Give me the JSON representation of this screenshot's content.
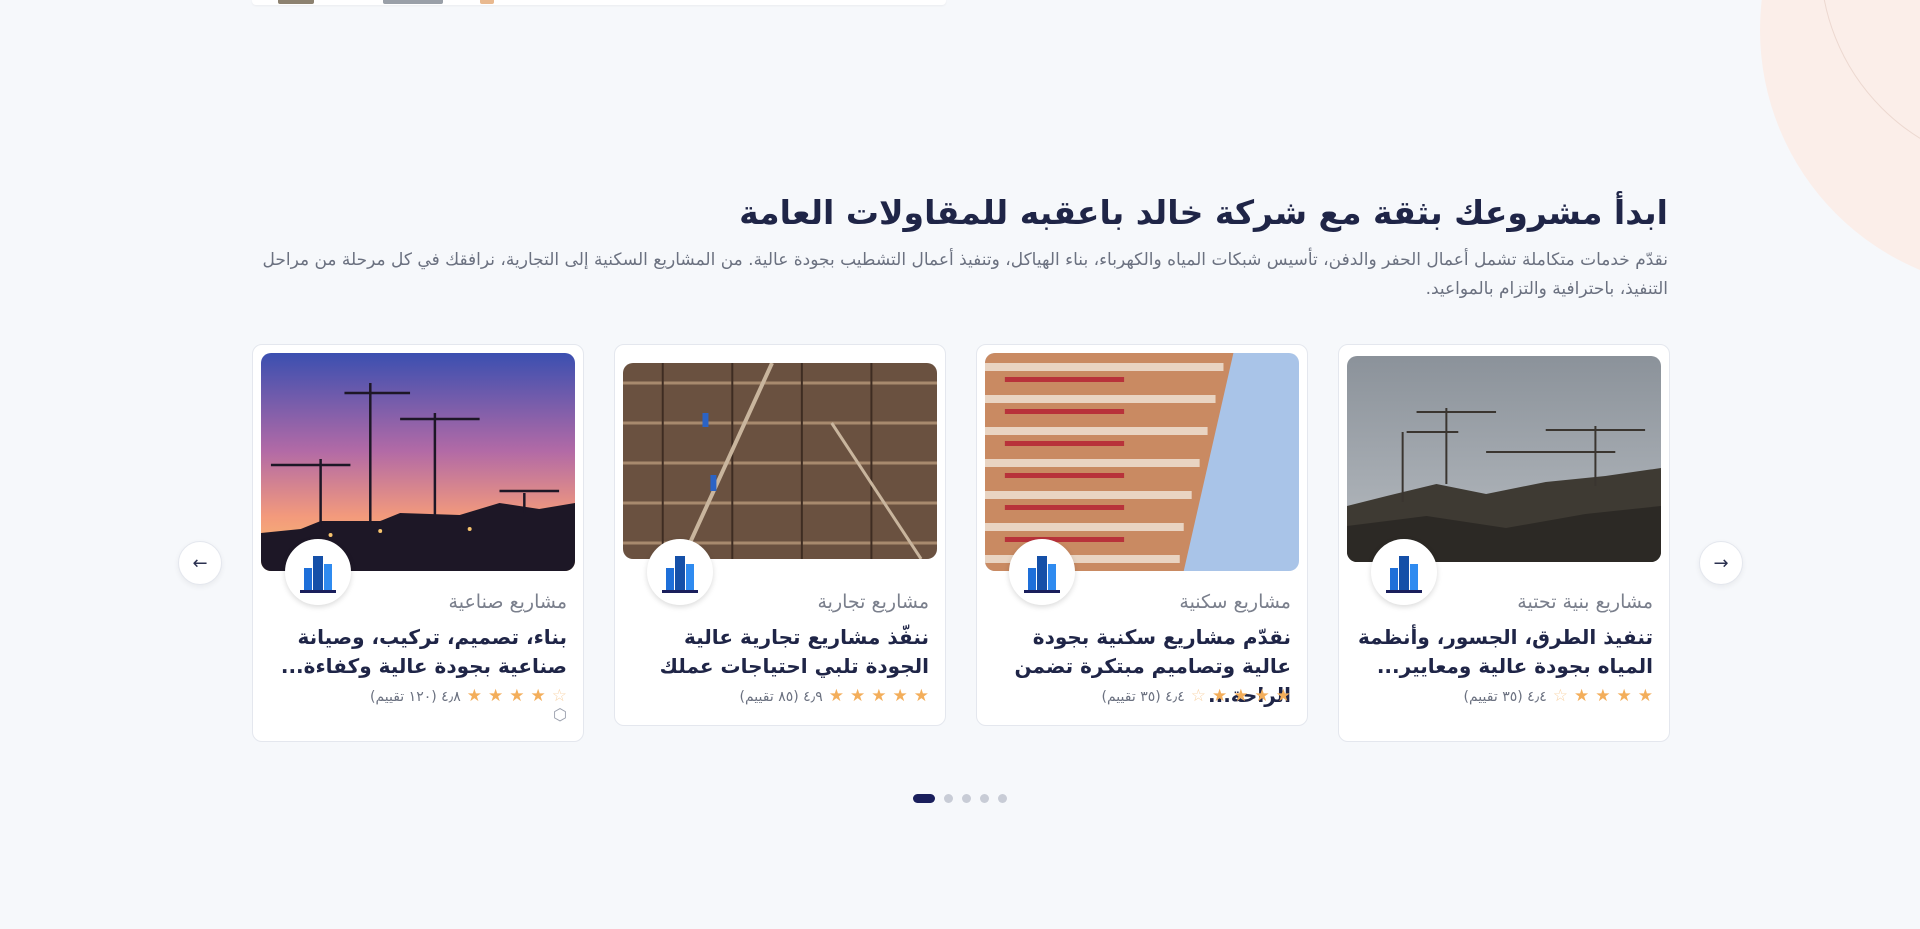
{
  "section": {
    "title": "ابدأ مشروعك بثقة مع شركة خالد باعقبه للمقاولات العامة",
    "description": "نقدّم خدمات متكاملة تشمل أعمال الحفر والدفن، تأسيس شبكات المياه والكهرباء، بناء الهياكل، وتنفيذ أعمال التشطيب بجودة عالية. من المشاريع السكنية إلى التجارية، نرافقك في كل مرحلة من مراحل التنفيذ، باحترافية والتزام بالمواعيد."
  },
  "cards": [
    {
      "category": "مشاريع بنية تحتية",
      "title": "تنفيذ الطرق، الجسور، وأنظمة المياه بجودة عالية ومعايير...",
      "rating_text": "٤٫٤ (٣٥ تقييم)",
      "rating": 4.4,
      "photo_icon": "cranes-cloudy-sky-photo"
    },
    {
      "category": "مشاريع سكنية",
      "title": "نقدّم مشاريع سكنية بجودة عالية وتصاميم مبتكرة تضمن الراحة...",
      "rating_text": "٤٫٤ (٣٥ تقييم)",
      "rating": 4.4,
      "photo_icon": "residential-tower-photo"
    },
    {
      "category": "مشاريع تجارية",
      "title": "ننفّذ مشاريع تجارية عالية الجودة تلبي احتياجات عملك",
      "rating_text": "٤٫٩ (٨٥ تقييم)",
      "rating": 4.9,
      "photo_icon": "rebar-site-photo"
    },
    {
      "category": "مشاريع صناعية",
      "title": "بناء، تصميم، تركيب، وصيانة صناعية بجودة عالية وكفاءة...",
      "rating_text": "٤٫٨ (١٢٠ تقييم)",
      "rating": 4.8,
      "photo_icon": "cranes-sunset-photo"
    }
  ],
  "carousel": {
    "slide_count": 5,
    "active_index": 0
  },
  "colors": {
    "accent": "#1a1f5c",
    "star": "#f3ae5b",
    "logo_blue": "#1e6fd9"
  }
}
